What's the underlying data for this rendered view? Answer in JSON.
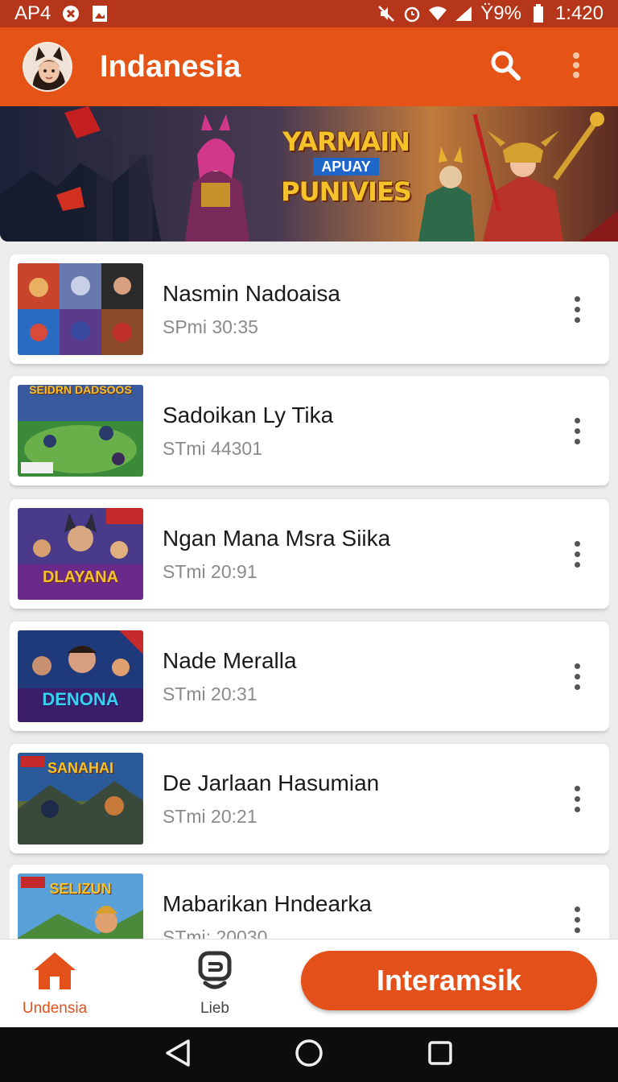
{
  "status_bar": {
    "carrier": "AP4",
    "battery": "Ϋ9%",
    "time": "1:420",
    "icons": [
      "close-circle-icon",
      "image-icon",
      "mute-icon",
      "alarm-icon",
      "wifi-icon",
      "signal-icon",
      "battery-icon"
    ]
  },
  "app_bar": {
    "title": "Indanesia",
    "icons": [
      "avatar",
      "search-icon",
      "more-vert-icon"
    ]
  },
  "banner": {
    "line1": "YARMAIN",
    "line2": "APUAY",
    "line3": "PUNIVIES"
  },
  "list": [
    {
      "title": "Nasmin Nadoaisa",
      "subtitle": "SPmi 30:35"
    },
    {
      "title": "Sadoikan Ly Tika",
      "subtitle": "STmi 44301"
    },
    {
      "title": "Ngan Mana Msra Siika",
      "subtitle": "STmi 20:91"
    },
    {
      "title": "Nade Meralla",
      "subtitle": "STmi 20:31"
    },
    {
      "title": "De Jarlaan Hasumian",
      "subtitle": "STmi 20:21"
    },
    {
      "title": "Mabarikan Hndearka",
      "subtitle": "STmi: 20030"
    }
  ],
  "thumbnails": [
    {
      "caption": ""
    },
    {
      "caption": "SEIDRN DADSOOS"
    },
    {
      "caption": "DLAYANA"
    },
    {
      "caption": "DENONA"
    },
    {
      "caption": "SANAHAI"
    },
    {
      "caption": "SELIZUN"
    }
  ],
  "bottom_nav": {
    "home_label": "Undensia",
    "lib_label": "Lieb",
    "cta_label": "Interamsik"
  },
  "colors": {
    "primary": "#e55317",
    "status_bar": "#b5361a",
    "accent_active": "#e3501a",
    "text_primary": "#1a1a1a",
    "text_secondary": "#8b8b8b"
  }
}
